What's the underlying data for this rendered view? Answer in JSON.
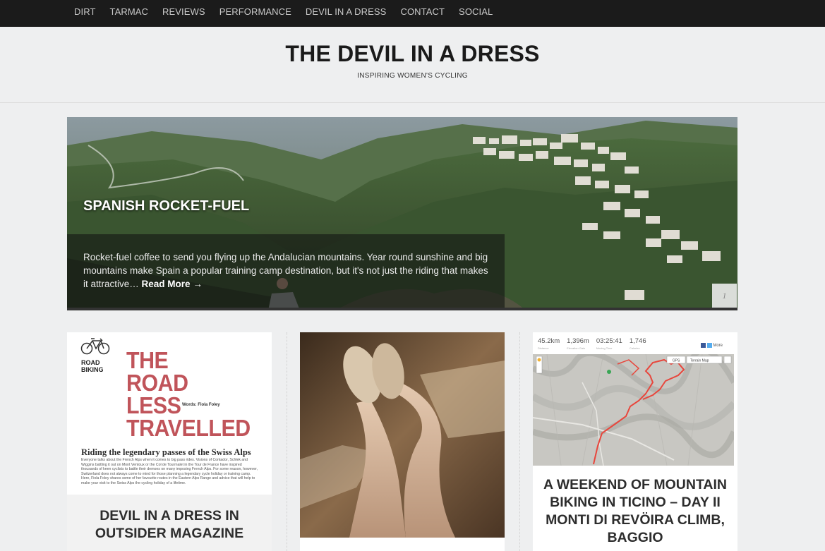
{
  "nav": {
    "items": [
      "DIRT",
      "TARMAC",
      "REVIEWS",
      "PERFORMANCE",
      "DEVIL IN A DRESS",
      "CONTACT",
      "SOCIAL"
    ]
  },
  "header": {
    "title": "THE DEVIL IN A DRESS",
    "tagline": "INSPIRING WOMEN'S CYCLING"
  },
  "hero": {
    "title": "SPANISH ROCKET-FUEL",
    "excerpt": "Rocket-fuel coffee to send you flying up the Andalucian mountains. Year round sunshine and big mountains make Spain a popular training camp destination, but it's not just the riding that makes it attractive…",
    "read_more": "Read More →",
    "slide_number": "1"
  },
  "cards": [
    {
      "title": "DEVIL IN A DRESS IN OUTSIDER MAGAZINE",
      "magazine": {
        "section": "ROAD BIKING",
        "headline_lines": [
          "THE",
          "ROAD",
          "LESS",
          "TRAVELLED"
        ],
        "byline": "Words: Fiola Foley",
        "subheading": "Riding the legendary passes of the Swiss Alps",
        "body": "Everyone talks about the French Alps when it comes to big pass rides. Visions of Contador, Schlek and Wiggins battling it out on Mont Ventoux or the Col de Tourmalet in the Tour de France have inspired thousands of keen cyclists to battle their demons on many imposing French Alps. For some reason, however, Switzerland does not always come to mind for those planning a legendary cycle holiday or training camp. Here, Fiola Foley shares some of her favourite routes in the Eastern Alps Range and advice that will help to make your visit to the Swiss Alps the cycling holiday of a lifetime."
      }
    },
    {
      "title": ""
    },
    {
      "title": "A WEEKEND OF MOUNTAIN BIKING IN TICINO – DAY II MONTI DI REVÖIRA CLIMB, BAGGIO",
      "map": {
        "stats": [
          {
            "value": "45.2km",
            "label": "Distance"
          },
          {
            "value": "1,396m",
            "label": "Elevation Gain"
          },
          {
            "value": "03:25:41",
            "label": "Moving Time"
          },
          {
            "value": "1,746",
            "label": "Calories"
          }
        ],
        "share": "More",
        "map_type": "Terrain Map",
        "gps_label": "GPS"
      }
    }
  ],
  "colors": {
    "nav_bg": "#1b1b1b",
    "page_bg": "#eeeff0",
    "magazine_red": "#c0545a",
    "route_red": "#e8463c"
  }
}
